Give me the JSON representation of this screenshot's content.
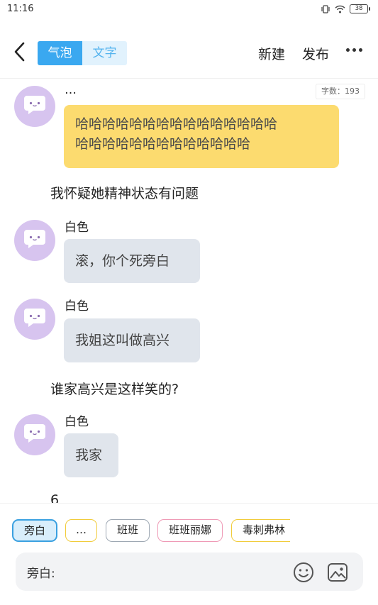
{
  "status_bar": {
    "time": "11:16",
    "battery": "38"
  },
  "header": {
    "tabs": [
      {
        "label": "气泡"
      },
      {
        "label": "文字"
      }
    ],
    "new_label": "新建",
    "publish_label": "发布"
  },
  "chat": {
    "word_count": "字数：193",
    "messages": [
      {
        "type": "bubble",
        "name": "…",
        "text_line1": "哈哈哈哈哈哈哈哈哈哈哈哈哈哈哈",
        "text_line2": "哈哈哈哈哈哈哈哈哈哈哈哈哈"
      },
      {
        "type": "narration",
        "text": "我怀疑她精神状态有问题"
      },
      {
        "type": "bubble",
        "name": "白色",
        "text": "滚，你个死旁白"
      },
      {
        "type": "bubble",
        "name": "白色",
        "text": "我姐这叫做高兴"
      },
      {
        "type": "narration",
        "text": "谁家高兴是这样笑的?"
      },
      {
        "type": "bubble",
        "name": "白色",
        "text": "我家"
      },
      {
        "type": "narration",
        "text": "6"
      }
    ]
  },
  "characters": [
    {
      "label": "旁白",
      "color": "#3aa0e0",
      "selected": true
    },
    {
      "label": "…",
      "color": "#f1cc3b"
    },
    {
      "label": "班班",
      "color": "#9ea8b3"
    },
    {
      "label": "班班丽娜",
      "color": "#ef9ab6"
    },
    {
      "label": "毒刺弗林",
      "color": "#f1cc3b"
    }
  ],
  "composer": {
    "speaker_label": "旁白:",
    "value": "",
    "placeholder": ""
  },
  "icons": {
    "back": "chevron-left-icon",
    "more": "more-horizontal-icon",
    "emoji": "smiley-icon",
    "image": "image-icon",
    "avatar": "speech-bubble-avatar-icon"
  },
  "colors": {
    "accent": "#3aa8f0",
    "avatar_bg": "#d7c4ef",
    "bubble_gray": "#e0e5ec",
    "bubble_yellow": "#fcdb6f"
  }
}
